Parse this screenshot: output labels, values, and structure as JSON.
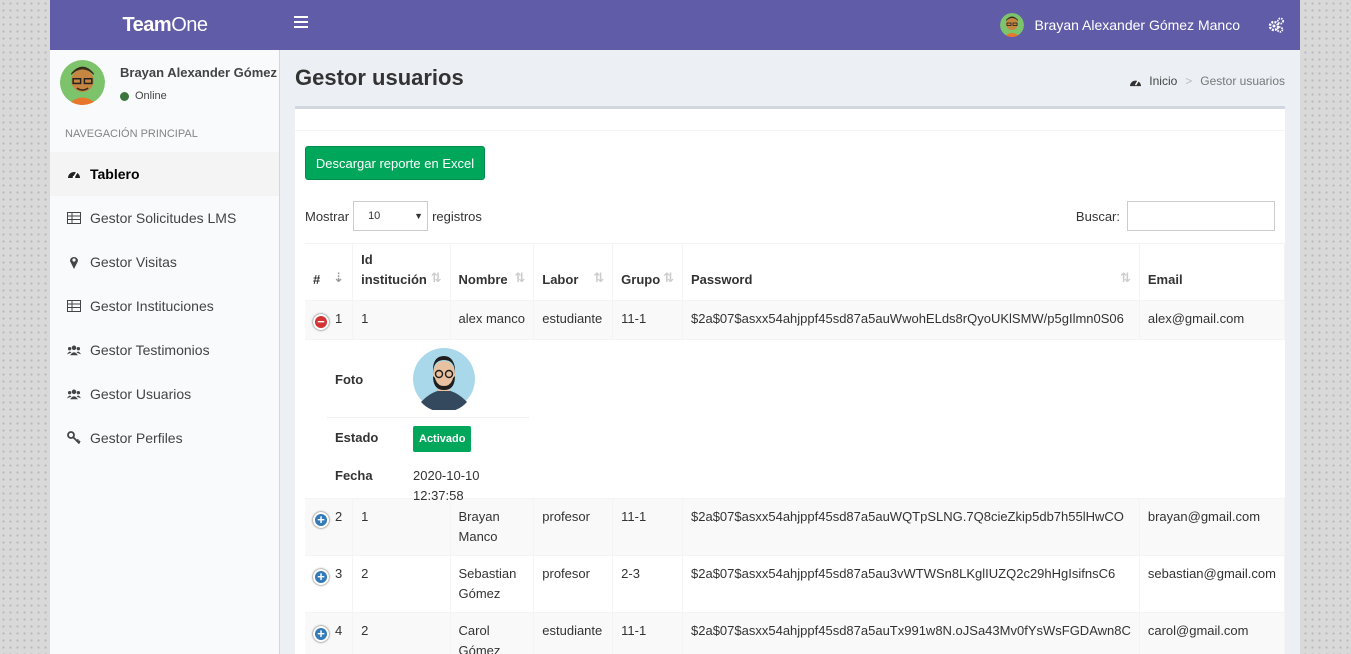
{
  "app": {
    "logo_bold": "Team",
    "logo_rest": "One"
  },
  "topbar": {
    "user_name": "Brayan Alexander Gómez Manco"
  },
  "sidebar": {
    "user_name": "Brayan Alexander Gómez Manco",
    "status": "Online",
    "nav_header": "NAVEGACIÓN PRINCIPAL",
    "items": [
      {
        "label": "Tablero",
        "icon": "dashboard-icon"
      },
      {
        "label": "Gestor Solicitudes LMS",
        "icon": "table-icon"
      },
      {
        "label": "Gestor Visitas",
        "icon": "map-marker-icon"
      },
      {
        "label": "Gestor Instituciones",
        "icon": "table-icon"
      },
      {
        "label": "Gestor Testimonios",
        "icon": "users-icon"
      },
      {
        "label": "Gestor Usuarios",
        "icon": "users-icon"
      },
      {
        "label": "Gestor Perfiles",
        "icon": "key-icon"
      }
    ]
  },
  "page": {
    "title": "Gestor usuarios",
    "breadcrumb": {
      "home": "Inicio",
      "current": "Gestor usuarios"
    }
  },
  "toolbar": {
    "excel_button": "Descargar reporte en Excel",
    "show_label": "Mostrar",
    "show_value": "10",
    "records_label": "registros",
    "search_label": "Buscar:",
    "search_value": ""
  },
  "table": {
    "headers": [
      "#",
      "Id institución",
      "Nombre",
      "Labor",
      "Grupo",
      "Password",
      "Email"
    ],
    "rows": [
      {
        "num": "1",
        "inst": "1",
        "name": "alex manco",
        "labor": "estudiante",
        "group": "11-1",
        "password": "$2a$07$asxx54ahjppf45sd87a5auWwohELds8rQyoUKlSMW/p5gIlmn0S06",
        "email": "alex@gmail.com",
        "expanded": true
      },
      {
        "num": "2",
        "inst": "1",
        "name": "Brayan Manco",
        "labor": "profesor",
        "group": "11-1",
        "password": "$2a$07$asxx54ahjppf45sd87a5auWQTpSLNG.7Q8cieZkip5db7h55lHwCO",
        "email": "brayan@gmail.com",
        "expanded": false
      },
      {
        "num": "3",
        "inst": "2",
        "name": "Sebastian Gómez",
        "labor": "profesor",
        "group": "2-3",
        "password": "$2a$07$asxx54ahjppf45sd87a5au3vWTWSn8LKglIUZQ2c29hHgIsifnsC6",
        "email": "sebastian@gmail.com",
        "expanded": false
      },
      {
        "num": "4",
        "inst": "2",
        "name": "Carol Gómez",
        "labor": "estudiante",
        "group": "11-1",
        "password": "$2a$07$asxx54ahjppf45sd87a5auTx991w8N.oJSa43Mv0fYsWsFGDAwn8C",
        "email": "carol@gmail.com",
        "expanded": false
      }
    ],
    "child": {
      "photo_label": "Foto",
      "state_label": "Estado",
      "state_value": "Activado",
      "date_label": "Fecha",
      "date_value": "2020-10-10 12:37:58"
    }
  },
  "colors": {
    "topbar": "#605ca8",
    "success": "#00a65a",
    "danger": "#d33333",
    "primary": "#337ab7"
  }
}
